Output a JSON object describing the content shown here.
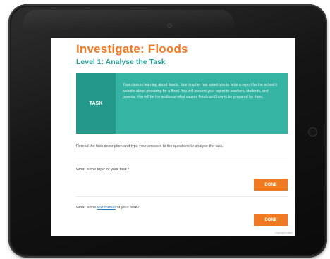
{
  "page": {
    "title": "Investigate: Floods",
    "subtitle": "Level 1: Analyse the Task"
  },
  "task": {
    "label": "TASK",
    "text": "Your class is learning about floods. Your teacher has asked you to write a report for the school's website about preparing for a flood. You will present your report to teachers, students, and parents. You will be the audience what causes floods and how to be prepared for them."
  },
  "instructions": "Reread the task description and type your answers to the questions to analyse the task.",
  "questions": [
    {
      "text_before": "What is the topic of your task?",
      "link_text": "",
      "text_after": "",
      "button_label": "DONE"
    },
    {
      "text_before": "What is the ",
      "link_text": "text format",
      "text_after": " of your task?",
      "button_label": "DONE"
    }
  ],
  "footnote": "Copyright notice",
  "colors": {
    "accent_orange": "#f07a22",
    "teal": "#35b3a3",
    "teal_dark": "#249989",
    "subtitle_teal": "#2ba39a"
  },
  "icons": {
    "camera": "camera-icon",
    "home_button": "home-button-icon"
  }
}
